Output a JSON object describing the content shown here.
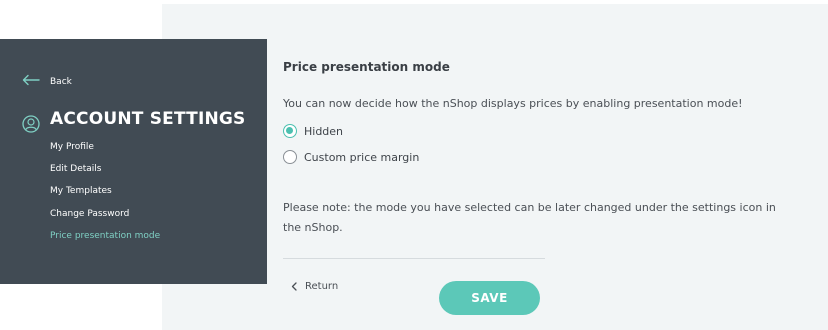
{
  "sidebar": {
    "back_label": "Back",
    "title": "ACCOUNT SETTINGS",
    "items": [
      {
        "label": "My Profile",
        "active": false
      },
      {
        "label": "Edit Details",
        "active": false
      },
      {
        "label": "My Templates",
        "active": false
      },
      {
        "label": "Change Password",
        "active": false
      },
      {
        "label": "Price presentation mode",
        "active": true
      }
    ]
  },
  "main": {
    "section_title": "Price presentation mode",
    "intro": "You can now decide how the nShop displays prices by enabling presentation mode!",
    "options": [
      {
        "label": "Hidden",
        "selected": true
      },
      {
        "label": "Custom price margin",
        "selected": false
      }
    ],
    "note": "Please note: the mode you have selected can be later changed under the settings icon in the nShop.",
    "return_label": "Return",
    "save_label": "SAVE"
  },
  "colors": {
    "sidebar_bg": "#414b54",
    "accent": "#5cc8b8",
    "active_nav": "#7fd0c4",
    "panel_bg": "#f2f5f6"
  },
  "icons": {
    "back": "arrow-left-icon",
    "profile": "user-circle-icon",
    "return": "chevron-left-icon"
  }
}
